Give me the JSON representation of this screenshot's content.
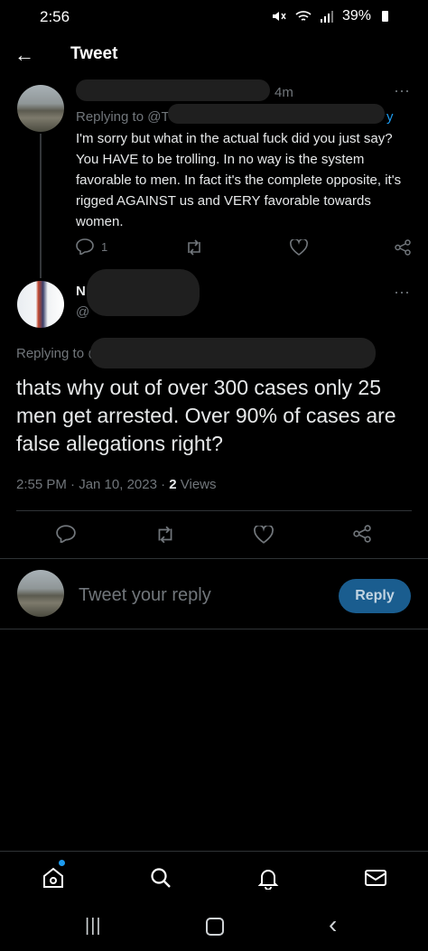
{
  "status_bar": {
    "time": "2:56",
    "battery": "39%"
  },
  "header": {
    "back_label": "←",
    "title": "Tweet"
  },
  "tweet1": {
    "time_ago": "4m",
    "replying_prefix": "Replying to @T",
    "replying_suffix": "y",
    "text": "I'm sorry but what in the actual fuck did you just say? You HAVE to be trolling. In no way is the system favorable to men. In fact it's the complete opposite, it's rigged AGAINST us and VERY favorable towards women.",
    "reply_count": "1",
    "more_label": "···"
  },
  "tweet2": {
    "name_initial": "N",
    "handle_prefix": "@",
    "more_label": "···",
    "replying_prefix": "Replying to @",
    "text": "thats why out of over 300 cases only 25 men get arrested. Over 90% of cases are false allegations right?",
    "timestamp": "2:55 PM · Jan 10, 2023 · ",
    "views_count": "2",
    "views_label": " Views"
  },
  "reply_box": {
    "placeholder": "Tweet your reply",
    "button_label": "Reply"
  },
  "colors": {
    "background": "#000000",
    "text": "#e7e9ea",
    "muted": "#71767b",
    "accent": "#1d9bf0",
    "reply_button": "#1a5d8f"
  },
  "bottom_nav": {
    "items": [
      "home-icon",
      "search-icon",
      "bell-icon",
      "mail-icon"
    ],
    "home_has_dot": true
  },
  "system_nav": {
    "recents_label": "|||",
    "back_label": "‹"
  }
}
